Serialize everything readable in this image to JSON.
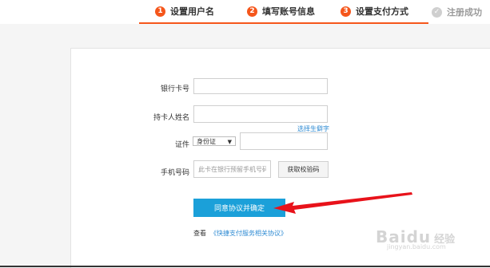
{
  "steps": [
    {
      "number": "1",
      "label": "设置用户名"
    },
    {
      "number": "2",
      "label": "填写账号信息"
    },
    {
      "number": "3",
      "label": "设置支付方式"
    },
    {
      "number": "✓",
      "label": "注册成功"
    }
  ],
  "form": {
    "card_number_label": "银行卡号",
    "card_number_value": "",
    "holder_name_label": "持卡人姓名",
    "holder_name_value": "",
    "rare_char_link": "选择生僻字",
    "id_label": "证件",
    "id_type_selected": "身份证",
    "id_number_value": "",
    "phone_label": "手机号码",
    "phone_placeholder": "此卡在银行预留手机号码",
    "get_code_button": "获取校验码",
    "submit_button": "同意协议并确定",
    "agreement_prefix": "查看",
    "agreement_link": "《快捷支付服务相关协议》"
  },
  "watermark": {
    "brand": "Baidu",
    "brand_suffix": "经验",
    "url": "jingyan.baidu.com"
  },
  "colors": {
    "accent": "#f5561b",
    "primary_button": "#1ba0d9",
    "link": "#2f8bd3",
    "arrow": "#e8121a"
  }
}
